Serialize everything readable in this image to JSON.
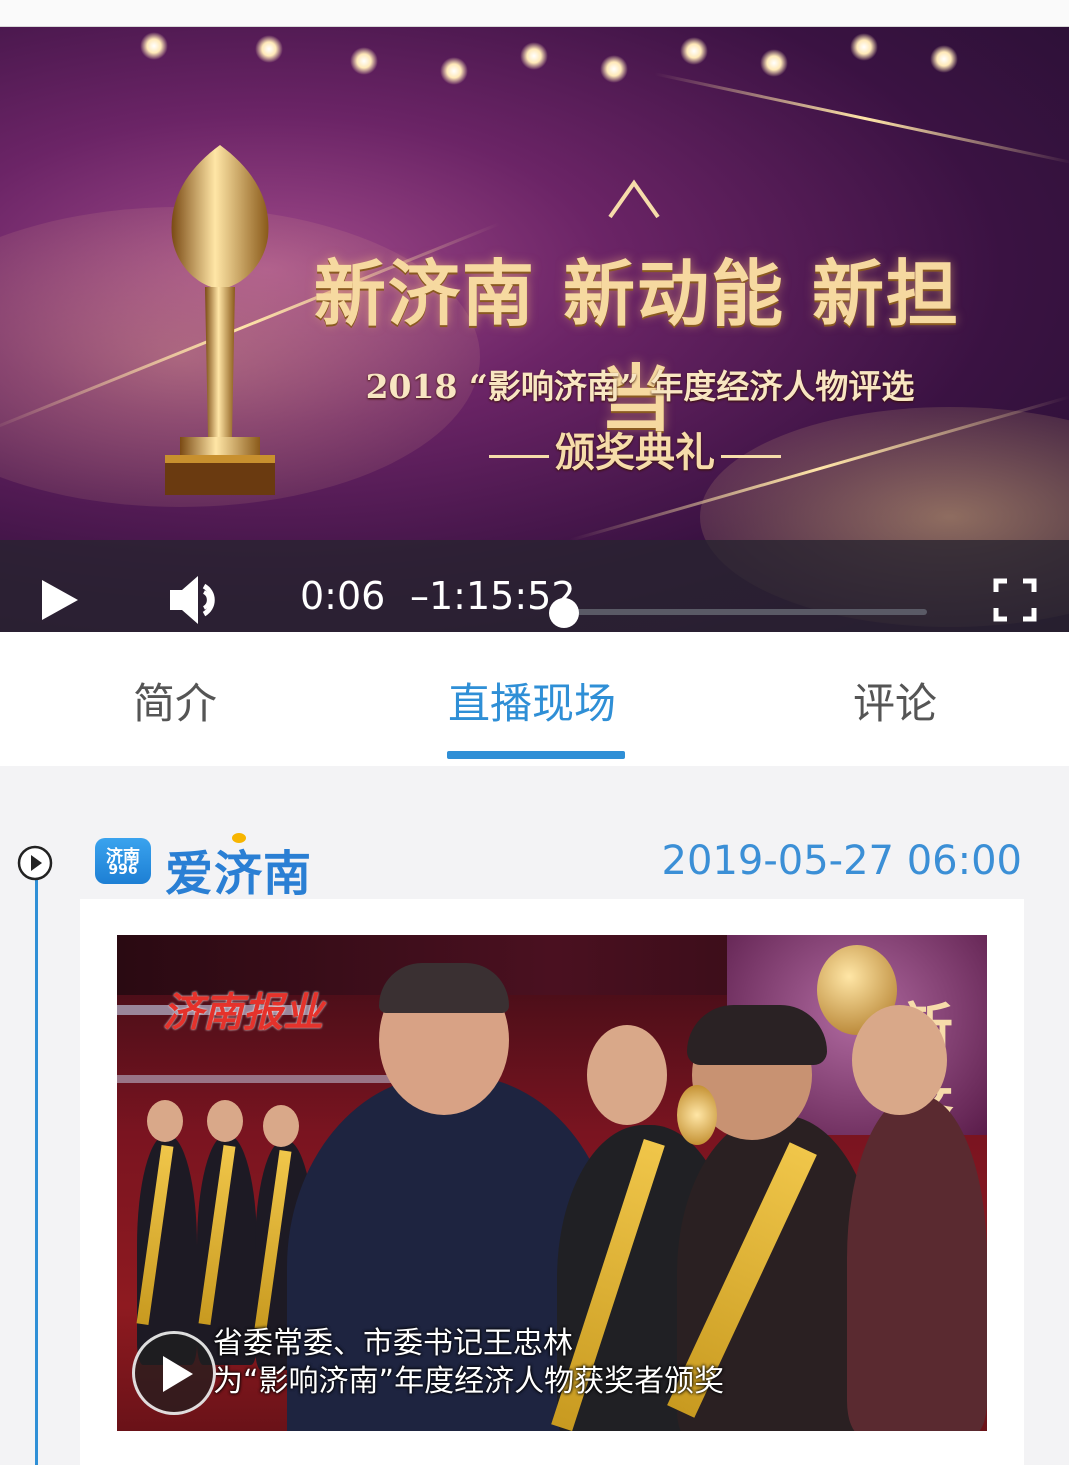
{
  "video": {
    "title": "新济南 新动能 新担当",
    "subtitle": "2018 “影响济南” 年度经济人物评选",
    "ceremony": "颁奖典礼",
    "current_time": "0:06",
    "remaining_time": "–1:15:52",
    "progress_fraction": 0.0
  },
  "tabs": [
    {
      "label": "简介"
    },
    {
      "label": "直播现场"
    },
    {
      "label": "评论"
    }
  ],
  "active_tab": "直播现场",
  "post": {
    "app_icon_text_top": "济南",
    "app_icon_text_bottom": "996",
    "source": "爱济南",
    "timestamp": "2019-05-27 06:00",
    "watermark": "济南报业",
    "caption_line1": "省委常委、市委书记王忠林",
    "caption_line2": "为“影响济南”年度经济人物获奖者颁奖"
  },
  "colors": {
    "accent": "#2f8fd6",
    "video_bg": "#4a1a52"
  }
}
